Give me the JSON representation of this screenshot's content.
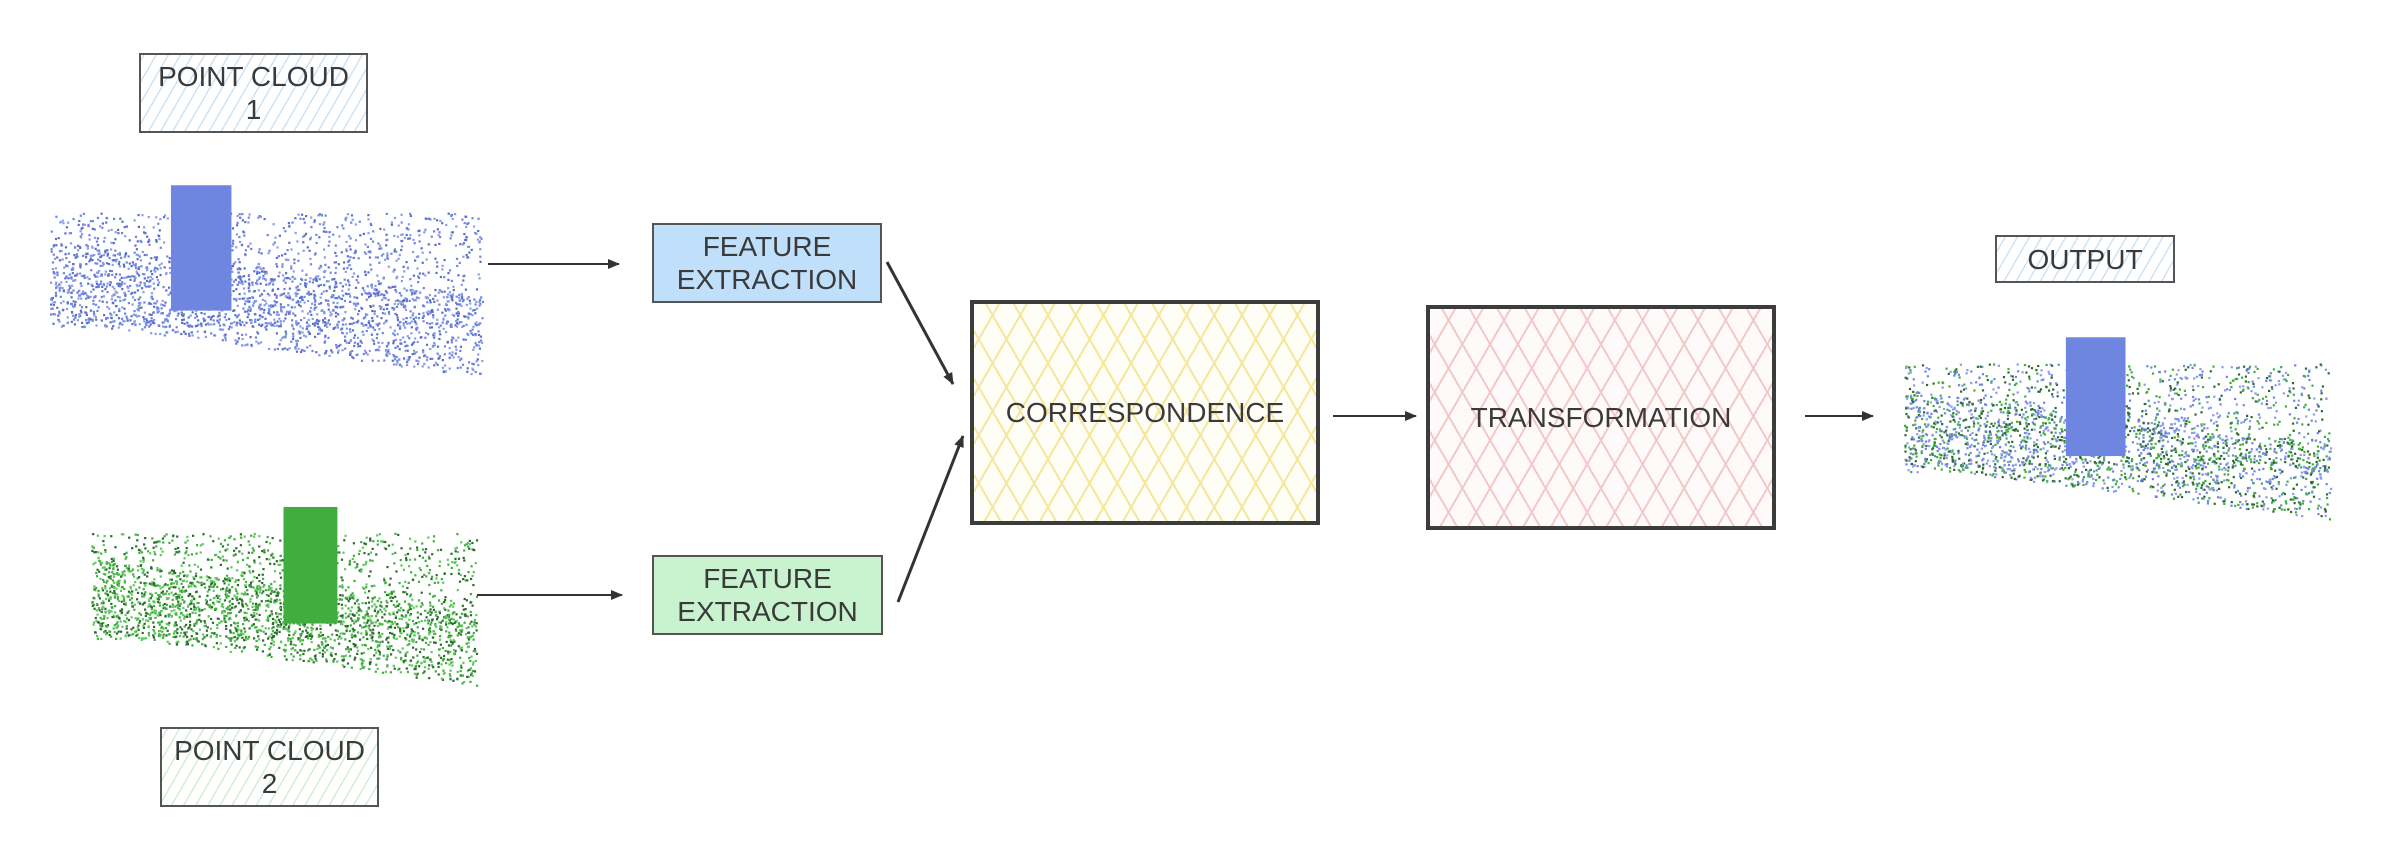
{
  "nodes": {
    "point_cloud_1": {
      "label": "POINT CLOUD\n1"
    },
    "point_cloud_2": {
      "label": "POINT CLOUD\n2"
    },
    "feature_extraction_1": {
      "label": "FEATURE\nEXTRACTION"
    },
    "feature_extraction_2": {
      "label": "FEATURE\nEXTRACTION"
    },
    "correspondence": {
      "label": "CORRESPONDENCE"
    },
    "transformation": {
      "label": "TRANSFORMATION"
    },
    "output": {
      "label": "OUTPUT"
    }
  },
  "colors": {
    "cloud_1": "#6f86e0",
    "cloud_2": "#3fae3f",
    "cloud_2_dark": "#2c6b2c",
    "feature_1_fill": "#bfdffb",
    "feature_2_fill": "#c9f3cf",
    "correspondence_hatch": "#f5e79a",
    "transformation_hatch": "#f4c8c8",
    "arrow": "#333333"
  },
  "edges": [
    [
      "point_cloud_1",
      "feature_extraction_1"
    ],
    [
      "point_cloud_2",
      "feature_extraction_2"
    ],
    [
      "feature_extraction_1",
      "correspondence"
    ],
    [
      "feature_extraction_2",
      "correspondence"
    ],
    [
      "correspondence",
      "transformation"
    ],
    [
      "transformation",
      "output"
    ]
  ]
}
